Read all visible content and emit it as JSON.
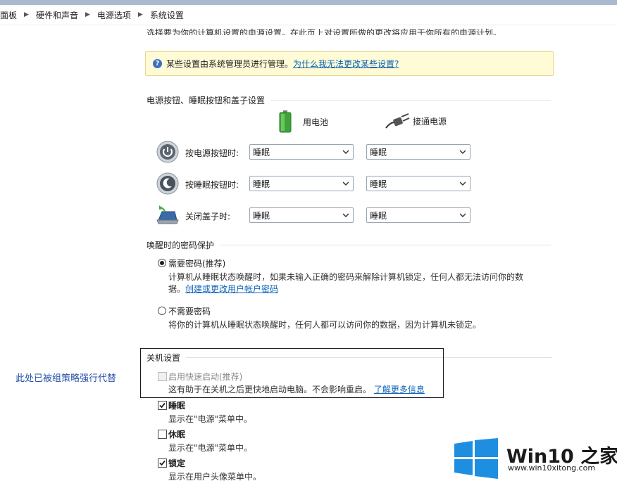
{
  "breadcrumb": [
    "面板",
    "硬件和声音",
    "电源选项",
    "系统设置"
  ],
  "intro_text": "选择要为你的计算机设置的电源设置。在此页上对设置所做的更改将应用于你所有的电源计划。",
  "info_bar": {
    "text": "某些设置由系统管理员进行管理。",
    "link": "为什么我无法更改某些设置?"
  },
  "power_section": {
    "title": "电源按钮、睡眠按钮和盖子设置",
    "col_battery": "用电池",
    "col_plugged": "接通电源",
    "rows": [
      {
        "label": "按电源按钮时:",
        "battery": "睡眠",
        "plugged": "睡眠"
      },
      {
        "label": "按睡眠按钮时:",
        "battery": "睡眠",
        "plugged": "睡眠"
      },
      {
        "label": "关闭盖子时:",
        "battery": "睡眠",
        "plugged": "睡眠"
      }
    ]
  },
  "password_section": {
    "title": "唤醒时的密码保护",
    "require": {
      "label": "需要密码(推荐)",
      "desc_line1": "计算机从睡眠状态唤醒时，如果未输入正确的密码来解除计算机锁定，任何人都无法访问你的数",
      "desc_line2_prefix": "据。",
      "desc_link": "创建或更改用户帐户密码",
      "selected": true
    },
    "no_require": {
      "label": "不需要密码",
      "desc": "将你的计算机从睡眠状态唤醒时，任何人都可以访问你的数据，因为计算机未锁定。",
      "selected": false
    }
  },
  "shutdown_section": {
    "title": "关机设置",
    "fast_startup": {
      "label": "启用快速启动(推荐)",
      "desc": "这有助于在关机之后更快地启动电脑。不会影响重启。",
      "link": "了解更多信息",
      "checked": false,
      "disabled": true
    },
    "sleep": {
      "label": "睡眠",
      "desc": "显示在\"电源\"菜单中。",
      "checked": true
    },
    "hibernate": {
      "label": "休眠",
      "desc": "显示在\"电源\"菜单中。",
      "checked": false
    },
    "lock": {
      "label": "锁定",
      "desc": "显示在用户头像菜单中。",
      "checked": true
    }
  },
  "annotation": "此处已被组策略强行代替",
  "watermark": {
    "name": "Win10 之家",
    "url": "www.win10xitong.com"
  },
  "colors": {
    "link": "#0b63b8",
    "info_bg": "#fefbd6",
    "annotation": "#2a52a8",
    "logo_blue": "#1e8fe0"
  }
}
